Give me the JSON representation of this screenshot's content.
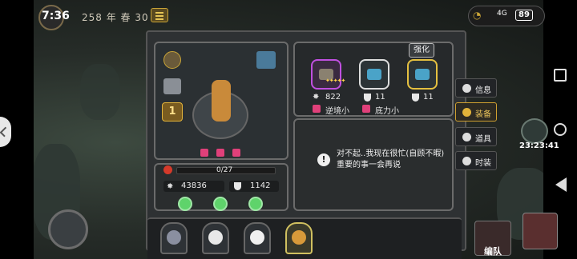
{
  "hud": {
    "time": "7:36",
    "date": "258 年 春 30",
    "wifi_icon": "wifi-icon",
    "signal": "4G",
    "battery": "89"
  },
  "equipment": {
    "enhance_label": "强化",
    "slots": [
      {
        "value": "822",
        "rarity": "purple",
        "stars": "✦✦✦✦✦"
      },
      {
        "value": "11",
        "rarity": "white"
      },
      {
        "value": "11",
        "rarity": "gold"
      }
    ],
    "traits": [
      "逆境小",
      "底力小"
    ]
  },
  "character": {
    "level": "1",
    "hp_text": "0/27",
    "hp_fraction": 0.0,
    "attack": "43836",
    "defense": "1142"
  },
  "message": {
    "text": "对不起..我现在很忙(自顾不暇)重要的事一会再说"
  },
  "side_menu": [
    {
      "label": "信息",
      "icon": "info-icon",
      "active": false
    },
    {
      "label": "装备",
      "icon": "equip-icon",
      "active": true
    },
    {
      "label": "道具",
      "icon": "item-icon",
      "active": false
    },
    {
      "label": "时装",
      "icon": "costume-icon",
      "active": false
    }
  ],
  "party": {
    "members": [
      "member-1",
      "member-2",
      "member-3",
      "member-4"
    ],
    "selected_index": 3
  },
  "troop_label": "编队",
  "event_timer": "23:23:41",
  "colors": {
    "accent_gold": "#e2b33a",
    "rarity_purple": "#c050e0",
    "trait_pink": "#e0407a",
    "potion_green": "#5fd36b"
  }
}
